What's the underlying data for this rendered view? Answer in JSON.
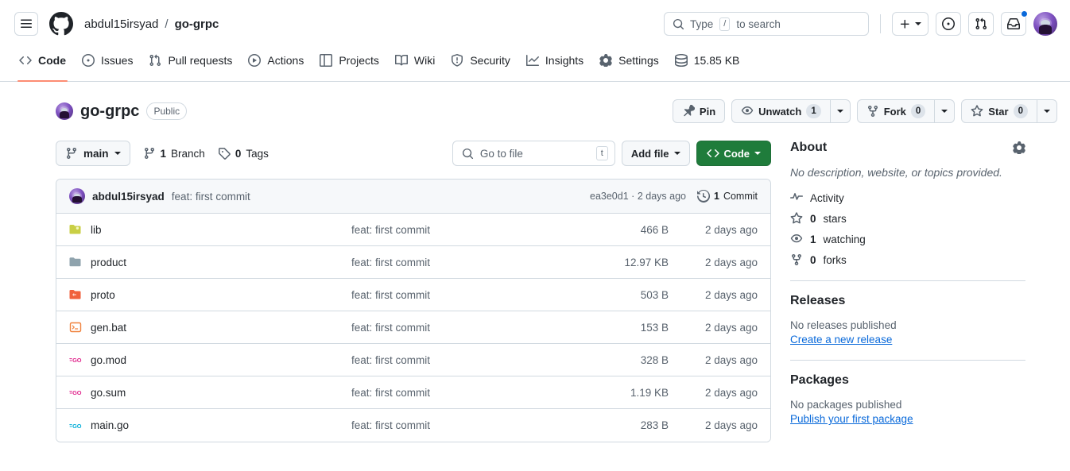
{
  "header": {
    "menu_icon": "hamburger-icon",
    "logo_icon": "github-logo-icon",
    "owner": "abdul15irsyad",
    "separator": "/",
    "repo": "go-grpc",
    "search": {
      "icon": "search-icon",
      "prefix": "Type",
      "key": "/",
      "suffix": "to search",
      "placeholder": "Type / to search"
    },
    "create_button": "plus-icon",
    "issues_icon": "issue-opened-icon",
    "pulls_icon": "git-pull-request-icon",
    "inbox_icon": "inbox-icon",
    "avatar": "user-avatar"
  },
  "nav": {
    "tabs": [
      {
        "label": "Code",
        "icon": "code-icon",
        "active": true
      },
      {
        "label": "Issues",
        "icon": "issue-opened-icon",
        "active": false
      },
      {
        "label": "Pull requests",
        "icon": "git-pull-request-icon",
        "active": false
      },
      {
        "label": "Actions",
        "icon": "play-icon",
        "active": false
      },
      {
        "label": "Projects",
        "icon": "table-icon",
        "active": false
      },
      {
        "label": "Wiki",
        "icon": "book-icon",
        "active": false
      },
      {
        "label": "Security",
        "icon": "shield-icon",
        "active": false
      },
      {
        "label": "Insights",
        "icon": "graph-icon",
        "active": false
      },
      {
        "label": "Settings",
        "icon": "gear-icon",
        "active": false
      },
      {
        "label": "15.85 KB",
        "icon": "database-icon",
        "active": false
      }
    ]
  },
  "repo": {
    "name": "go-grpc",
    "visibility": "Public",
    "actions": {
      "pin": {
        "label": "Pin",
        "icon": "pin-icon"
      },
      "watch": {
        "label": "Unwatch",
        "count": "1",
        "icon": "eye-icon"
      },
      "fork": {
        "label": "Fork",
        "count": "0",
        "icon": "repo-forked-icon"
      },
      "star": {
        "label": "Star",
        "count": "0",
        "icon": "star-icon"
      }
    }
  },
  "toolbar": {
    "branch": {
      "label": "main",
      "icon": "git-branch-icon"
    },
    "branches": {
      "count": "1",
      "label": "Branch",
      "icon": "git-branch-icon"
    },
    "tags": {
      "count": "0",
      "label": "Tags",
      "icon": "tag-icon"
    },
    "gotofile": {
      "placeholder": "Go to file",
      "key": "t",
      "icon": "search-icon"
    },
    "addfile": "Add file",
    "code": {
      "label": "Code",
      "icon": "code-icon",
      "color": "#1f7c3b"
    }
  },
  "commitbar": {
    "author": "abdul15irsyad",
    "message": "feat: first commit",
    "hash": "ea3e0d1",
    "hash_sep": "·",
    "relative": "2 days ago",
    "commits_count": "1",
    "commits_label": "Commit",
    "history_icon": "history-icon"
  },
  "files": [
    {
      "name": "lib",
      "icon": "folder-open-icon",
      "color": "#c9cf45",
      "message": "feat: first commit",
      "size": "466 B",
      "date": "2 days ago"
    },
    {
      "name": "product",
      "icon": "folder-icon",
      "color": "#8fa3ad",
      "message": "feat: first commit",
      "size": "12.97 KB",
      "date": "2 days ago"
    },
    {
      "name": "proto",
      "icon": "folder-open-icon",
      "color": "#f0613c",
      "message": "feat: first commit",
      "size": "503 B",
      "date": "2 days ago"
    },
    {
      "name": "gen.bat",
      "icon": "terminal-file-icon",
      "color": "#f0813c",
      "message": "feat: first commit",
      "size": "153 B",
      "date": "2 days ago"
    },
    {
      "name": "go.mod",
      "icon": "go-file-icon",
      "color": "#e0258c",
      "message": "feat: first commit",
      "size": "328 B",
      "date": "2 days ago"
    },
    {
      "name": "go.sum",
      "icon": "go-file-icon",
      "color": "#e0258c",
      "message": "feat: first commit",
      "size": "1.19 KB",
      "date": "2 days ago"
    },
    {
      "name": "main.go",
      "icon": "go-file-icon",
      "color": "#00add8",
      "message": "feat: first commit",
      "size": "283 B",
      "date": "2 days ago"
    }
  ],
  "sidebar": {
    "about": {
      "title": "About",
      "gear_icon": "gear-icon",
      "description": "No description, website, or topics provided.",
      "stats": [
        {
          "label": "Activity",
          "icon": "pulse-icon",
          "bold": ""
        },
        {
          "label": "stars",
          "icon": "star-icon",
          "bold": "0"
        },
        {
          "label": "watching",
          "icon": "eye-icon",
          "bold": "1"
        },
        {
          "label": "forks",
          "icon": "repo-forked-icon",
          "bold": "0"
        }
      ]
    },
    "releases": {
      "title": "Releases",
      "empty": "No releases published",
      "link": "Create a new release"
    },
    "packages": {
      "title": "Packages",
      "empty": "No packages published",
      "link": "Publish your first package"
    }
  }
}
